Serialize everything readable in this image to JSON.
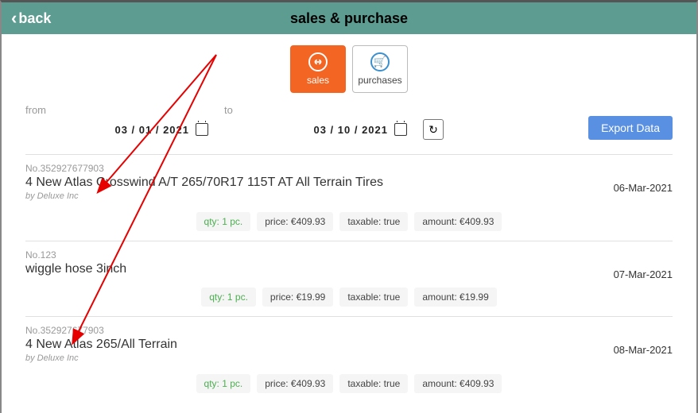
{
  "header": {
    "back_label": "back",
    "title": "sales & purchase"
  },
  "tabs": {
    "sales_label": "sales",
    "purchases_label": "purchases"
  },
  "filters": {
    "from_label": "from",
    "to_label": "to",
    "from_date": "03 / 01 / 2021",
    "to_date": "03 / 10 / 2021",
    "export_label": "Export Data"
  },
  "records": [
    {
      "no_prefix": "No.",
      "no": "352927677903",
      "title": "4 New Atlas Crosswind A/T 265/70R17 115T AT All Terrain Tires",
      "by_prefix": "by ",
      "by": "Deluxe Inc",
      "date": "06-Mar-2021",
      "qty_label": "qty:",
      "qty": "1 pc.",
      "price_label": "price:",
      "price": "€409.93",
      "tax_label": "taxable:",
      "tax": "true",
      "amount_label": "amount:",
      "amount": "€409.93"
    },
    {
      "no_prefix": "No.",
      "no": "123",
      "title": "wiggle hose 3inch",
      "date": "07-Mar-2021",
      "qty_label": "qty:",
      "qty": "1 pc.",
      "price_label": "price:",
      "price": "€19.99",
      "tax_label": "taxable:",
      "tax": "true",
      "amount_label": "amount:",
      "amount": "€19.99"
    },
    {
      "no_prefix": "No.",
      "no": "352927677903",
      "title": "4 New Atlas 265/All Terrain",
      "by_prefix": "by ",
      "by": "Deluxe Inc",
      "date": "08-Mar-2021",
      "qty_label": "qty:",
      "qty": "1 pc.",
      "price_label": "price:",
      "price": "€409.93",
      "tax_label": "taxable:",
      "tax": "true",
      "amount_label": "amount:",
      "amount": "€409.93"
    }
  ]
}
